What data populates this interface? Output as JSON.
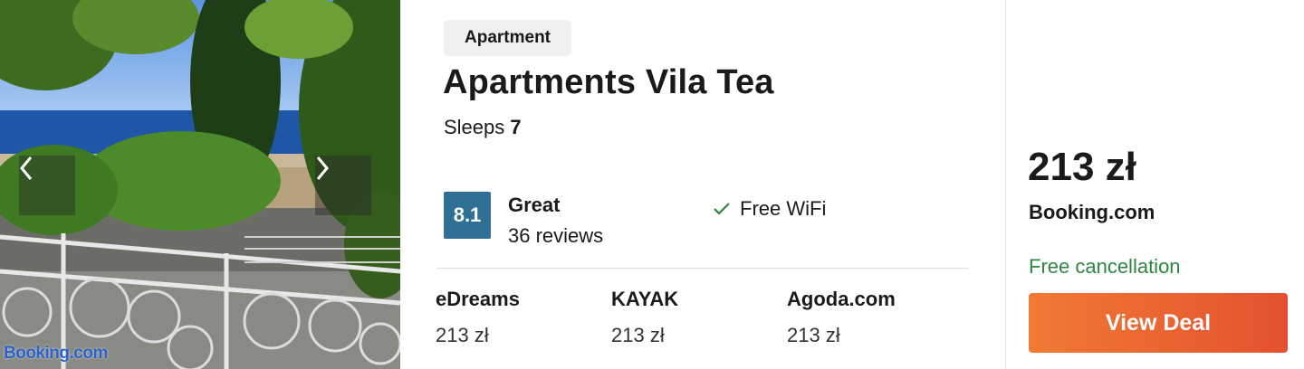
{
  "photo": {
    "prev_icon": "chevron-left-icon",
    "next_icon": "chevron-right-icon",
    "credit": "Booking.com"
  },
  "listing": {
    "type": "Apartment",
    "name": "Apartments Vila Tea",
    "sleeps_label": "Sleeps",
    "sleeps_count": "7",
    "rating": {
      "score": "8.1",
      "word": "Great",
      "reviews": "36 reviews",
      "badge_color": "#2f6f93"
    },
    "amenities": [
      {
        "icon": "check-icon",
        "label": "Free WiFi"
      }
    ],
    "providers": [
      {
        "name": "eDreams",
        "price": "213 zł"
      },
      {
        "name": "KAYAK",
        "price": "213 zł"
      },
      {
        "name": "Agoda.com",
        "price": "213 zł"
      }
    ]
  },
  "deal": {
    "price": "213 zł",
    "provider": "Booking.com",
    "cancellation": "Free cancellation",
    "cancellation_color": "#2e8540",
    "button_label": "View Deal",
    "button_color": "#e8602f"
  }
}
